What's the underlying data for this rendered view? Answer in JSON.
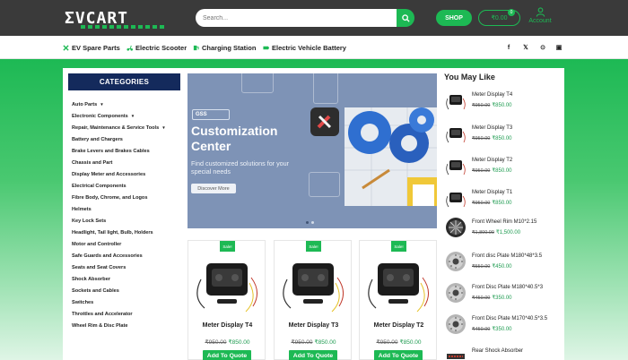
{
  "header": {
    "logo_text": "ΣVCART",
    "search_placeholder": "Search...",
    "shop_label": "SHOP",
    "cart_label": "₹0.00",
    "cart_count": "0",
    "account_label": "Account"
  },
  "nav": {
    "items": [
      {
        "label": "EV Spare Parts"
      },
      {
        "label": "Electric Scooter"
      },
      {
        "label": "Charging Station"
      },
      {
        "label": "Electric Vehicle Battery"
      }
    ],
    "social": [
      "f",
      "𝕏",
      "⊙",
      "▣"
    ]
  },
  "categories": {
    "title": "CATEGORIES",
    "items": [
      {
        "label": "Auto Parts",
        "caret": "▼"
      },
      {
        "label": "Electronic Components",
        "caret": "▼"
      },
      {
        "label": "Repair, Maintenance & Service Tools",
        "caret": "▼"
      },
      {
        "label": "Battery and Chargers",
        "caret": ""
      },
      {
        "label": "Brake Levers and Brakes Cables",
        "caret": ""
      },
      {
        "label": "Chassis and Part",
        "caret": ""
      },
      {
        "label": "Display Meter and Accessories",
        "caret": ""
      },
      {
        "label": "Electrical Components",
        "caret": ""
      },
      {
        "label": "Fibre Body, Chrome, and Logos",
        "caret": ""
      },
      {
        "label": "Helmets",
        "caret": ""
      },
      {
        "label": "Key Lock Sets",
        "caret": ""
      },
      {
        "label": "Headlight, Tail light, Bulb, Holders",
        "caret": ""
      },
      {
        "label": "Motor and Controller",
        "caret": ""
      },
      {
        "label": "Safe Guards and Accessories",
        "caret": ""
      },
      {
        "label": "Seats and Seat Covers",
        "caret": ""
      },
      {
        "label": "Shock Absorber",
        "caret": ""
      },
      {
        "label": "Sockets and Cables",
        "caret": ""
      },
      {
        "label": "Switches",
        "caret": ""
      },
      {
        "label": "Throttles and Accelerator",
        "caret": ""
      },
      {
        "label": "Wheel Rim & Disc Plate",
        "caret": ""
      }
    ]
  },
  "banner": {
    "tag": "GSS",
    "title": "Customization Center",
    "subtitle": "Find customized solutions for your special needs",
    "button": "Discover More"
  },
  "products": [
    {
      "badge": "Sale!",
      "name": "Meter Display T4",
      "old_price": "₹950.00",
      "price": "₹850.00",
      "button": "Add To Quote"
    },
    {
      "badge": "Sale!",
      "name": "Meter Display T3",
      "old_price": "₹950.00",
      "price": "₹850.00",
      "button": "Add To Quote"
    },
    {
      "badge": "Sale!",
      "name": "Meter Display T2",
      "old_price": "₹950.00",
      "price": "₹850.00",
      "button": "Add To Quote"
    }
  ],
  "sidebar": {
    "title": "You May Like",
    "items": [
      {
        "name": "Meter Display T4",
        "old_price": "₹950.00",
        "price": "₹850.00",
        "kind": "display"
      },
      {
        "name": "Meter Display T3",
        "old_price": "₹950.00",
        "price": "₹850.00",
        "kind": "display"
      },
      {
        "name": "Meter Display T2",
        "old_price": "₹950.00",
        "price": "₹850.00",
        "kind": "display"
      },
      {
        "name": "Meter Display T1",
        "old_price": "₹950.00",
        "price": "₹850.00",
        "kind": "display"
      },
      {
        "name": "Front Wheel Rim M10*2.15",
        "old_price": "₹1,800.00",
        "price": "₹1,500.00",
        "kind": "rim"
      },
      {
        "name": "Front disc Plate M180*48*3.5",
        "old_price": "₹550.00",
        "price": "₹450.00",
        "kind": "disc"
      },
      {
        "name": "Front Disc Plate M180*40.5*3",
        "old_price": "₹450.00",
        "price": "₹350.00",
        "kind": "disc"
      },
      {
        "name": "Front Disc Plate M170*40.5*3.5",
        "old_price": "₹450.00",
        "price": "₹350.00",
        "kind": "disc"
      },
      {
        "name": "Rear Shock Absorber",
        "old_price": "",
        "price": "",
        "kind": "shock"
      }
    ]
  },
  "colors": {
    "brand_green": "#1db954",
    "navy": "#142a5c",
    "topbar": "#3a3a3a"
  }
}
